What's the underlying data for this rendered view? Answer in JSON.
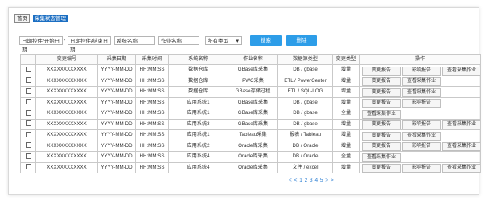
{
  "breadcrumb": {
    "home_label": "首页",
    "active_label": "采集状态管理"
  },
  "filters": {
    "start_date": "日期控件/开始日期",
    "separator": "-",
    "end_date": "日期控件/结束日期",
    "system_name": "系统名称",
    "job_name": "作业名称",
    "type_select": "所有类型",
    "search_label": "搜索",
    "delete_label": "删除"
  },
  "table": {
    "headers": [
      "",
      "变更编号",
      "采集日期",
      "采集时间",
      "系统名称",
      "作业名称",
      "数据源类型",
      "变更类型",
      "操作"
    ],
    "rows": [
      {
        "id": "XXXXXXXXXXXX",
        "date": "YYYY-MM-DD",
        "time": "HH:MM:SS",
        "system": "数据仓库",
        "job": "GBase库采集",
        "source": "DB / gbase",
        "change": "增量",
        "actions": [
          "变更报告",
          "影响报告",
          "查看采集作业"
        ]
      },
      {
        "id": "XXXXXXXXXXXX",
        "date": "YYYY-MM-DD",
        "time": "HH:MM:SS",
        "system": "数据仓库",
        "job": "PWC采集",
        "source": "ETL / PowerCenter",
        "change": "增量",
        "actions": [
          "变更报告",
          "查看采集作业"
        ]
      },
      {
        "id": "XXXXXXXXXXXX",
        "date": "YYYY-MM-DD",
        "time": "HH:MM:SS",
        "system": "数据仓库",
        "job": "GBase存储过程",
        "source": "ETL / SQL-LOG",
        "change": "增量",
        "actions": [
          "变更报告",
          "查看采集作业"
        ]
      },
      {
        "id": "XXXXXXXXXXXX",
        "date": "YYYY-MM-DD",
        "time": "HH:MM:SS",
        "system": "应用系统1",
        "job": "GBase库采集",
        "source": "DB / gbase",
        "change": "增量",
        "actions": [
          "变更报告",
          "影响报告"
        ]
      },
      {
        "id": "XXXXXXXXXXXX",
        "date": "YYYY-MM-DD",
        "time": "HH:MM:SS",
        "system": "应用系统1",
        "job": "GBase库采集",
        "source": "DB / gbase",
        "change": "全量",
        "actions": [
          "查看采集作业"
        ]
      },
      {
        "id": "XXXXXXXXXXXX",
        "date": "YYYY-MM-DD",
        "time": "HH:MM:SS",
        "system": "应用系统3",
        "job": "GBase库采集",
        "source": "DB / gbase",
        "change": "增量",
        "actions": [
          "变更报告",
          "影响报告",
          "查看采集作业"
        ]
      },
      {
        "id": "XXXXXXXXXXXX",
        "date": "YYYY-MM-DD",
        "time": "HH:MM:SS",
        "system": "应用系统1",
        "job": "Tableau采集",
        "source": "报表 / Tableau",
        "change": "增量",
        "actions": [
          "变更报告",
          "查看采集作业"
        ]
      },
      {
        "id": "XXXXXXXXXXXX",
        "date": "YYYY-MM-DD",
        "time": "HH:MM:SS",
        "system": "应用系统2",
        "job": "Oracle库采集",
        "source": "DB / Oracle",
        "change": "增量",
        "actions": [
          "变更报告",
          "影响报告",
          "查看采集作业"
        ]
      },
      {
        "id": "XXXXXXXXXXXX",
        "date": "YYYY-MM-DD",
        "time": "HH:MM:SS",
        "system": "应用系统4",
        "job": "Oracle库采集",
        "source": "DB / Oracle",
        "change": "全量",
        "actions": [
          "查看采集作业"
        ]
      },
      {
        "id": "XXXXXXXXXXXX",
        "date": "YYYY-MM-DD",
        "time": "HH:MM:SS",
        "system": "应用系统4",
        "job": "Oracle库采集",
        "source": "文件 / excel",
        "change": "增量",
        "actions": [
          "变更报告",
          "影响报告",
          "查看采集作业"
        ]
      }
    ]
  },
  "pagination": {
    "text": "< < 1 2 3 4 5 > >"
  },
  "colors": {
    "accent": "#2d9de8",
    "breadcrumb_active": "#1b6ec2",
    "pager": "#2d7fd3"
  }
}
